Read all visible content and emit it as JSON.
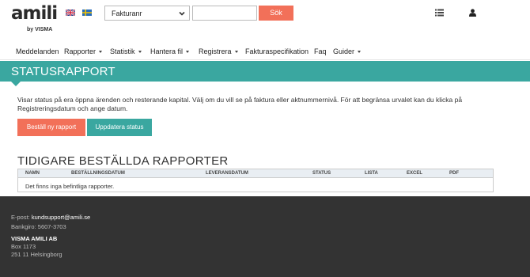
{
  "header": {
    "logo_text": "amili",
    "logo_sub": "by VISMA",
    "flags": [
      "english-flag-icon",
      "swedish-flag-icon"
    ],
    "search": {
      "selected_field": "Fakturanr",
      "input_value": "",
      "input_placeholder": "",
      "button_label": "Sök"
    },
    "icons": [
      "list-icon",
      "user-icon"
    ]
  },
  "nav": {
    "items": [
      {
        "label": "Meddelanden",
        "dropdown": false
      },
      {
        "label": "Rapporter",
        "dropdown": true
      },
      {
        "label": "Statistik",
        "dropdown": true
      },
      {
        "label": "Hantera fil",
        "dropdown": true
      },
      {
        "label": "Registrera",
        "dropdown": true
      },
      {
        "label": "Fakturaspecifikation",
        "dropdown": false
      },
      {
        "label": "Faq",
        "dropdown": false
      },
      {
        "label": "Guider",
        "dropdown": true
      }
    ]
  },
  "page": {
    "title": "STATUSRAPPORT",
    "intro_line1": "Visar status på era öppna ärenden och resterande kapital. Välj om du vill se på faktura eller aktnummernivå. För att begränsa urvalet kan du klicka på",
    "intro_line2": "Registreringsdatum och ange datum.",
    "order_button": "Beställ ny rapport",
    "update_button": "Uppdatera status"
  },
  "reports": {
    "title": "TIDIGARE BESTÄLLDA RAPPORTER",
    "columns": [
      "NAMN",
      "BESTÄLLNINGSDATUM",
      "LEVERANSDATUM",
      "STATUS",
      "LISTA",
      "EXCEL",
      "PDF"
    ],
    "empty_message": "Det finns inga befintliga rapporter."
  },
  "footer": {
    "email_label": "E-post:",
    "email": "kundsupport@amili.se",
    "bankgiro": "Bankgiro: 5607-3703",
    "company": "VISMA AMILI AB",
    "address_line1": "Box 1173",
    "address_line2": "251 11 Helsingborg"
  },
  "colors": {
    "accent_teal": "#3aa7a0",
    "accent_coral": "#f27059",
    "footer_bg": "#333333"
  }
}
